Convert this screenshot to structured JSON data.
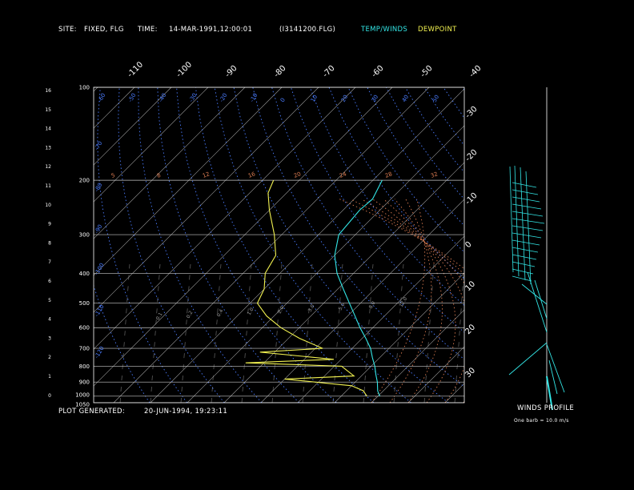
{
  "header": {
    "site_label": "SITE:",
    "site_value": "FIXED, FLG",
    "time_label": "TIME:",
    "time_value": "14-MAR-1991,12:00:01",
    "file_value": "(I3141200.FLG)",
    "legend_temp": "TEMP/WINDS",
    "legend_dew": "DEWPOINT"
  },
  "footer": {
    "generated_label": "PLOT GENERATED:",
    "generated_value": "20-JUN-1994, 19:23:11",
    "winds_title": "WINDS PROFILE",
    "barb_note": "One barb = 10.0 m/s"
  },
  "colors": {
    "background": "#000000",
    "frame": "#ffffff",
    "isobar": "#c8c8c8",
    "isotherm": "#a0a0a0",
    "dry_adiabat": "#4a7cff",
    "moist_adiabat": "#d87a50",
    "mixing_ratio": "#7a7a7a",
    "temperature": "#33e6e6",
    "dewpoint": "#f0f050",
    "wind": "#33e6e6"
  },
  "chart_data": {
    "type": "line",
    "title": "",
    "pressure_axis": {
      "ticks": [
        "100",
        "200",
        "300",
        "400",
        "500",
        "600",
        "700",
        "800",
        "900",
        "1000",
        "1050"
      ],
      "values": [
        100,
        200,
        300,
        400,
        500,
        600,
        700,
        800,
        900,
        1000,
        1050
      ],
      "range": [
        100,
        1050
      ]
    },
    "height_axis": {
      "ticks": [
        "16",
        "15",
        "14",
        "13",
        "12",
        "11",
        "10",
        "9",
        "8",
        "7",
        "6",
        "5",
        "4",
        "3",
        "2",
        "1",
        "0"
      ],
      "values": [
        16,
        15,
        14,
        13,
        12,
        11,
        10,
        9,
        8,
        7,
        6,
        5,
        4,
        3,
        2,
        1,
        0
      ]
    },
    "top_temp_labels": [
      "-110",
      "-100",
      "-90",
      "-80",
      "-70",
      "-60",
      "-50",
      "-40"
    ],
    "right_temp_labels": [
      "-30",
      "-20",
      "-10",
      "0",
      "10",
      "20",
      "30"
    ],
    "dry_adiabat_labels_top": [
      "-60",
      "-50",
      "-40",
      "-30",
      "-20",
      "-10",
      "0",
      "10",
      "20",
      "30",
      "40",
      "50"
    ],
    "dry_adiabat_labels_left": [
      "-70",
      "-80",
      "-90",
      "-100",
      "-110",
      "-120"
    ],
    "moist_labels": [
      "5",
      "8",
      "12",
      "16",
      "20",
      "24",
      "28",
      "32"
    ],
    "mixing_ratio_labels": [
      "0.1",
      "0.2",
      "0.4",
      "1.0",
      "2.0",
      "3.0",
      "5.0",
      "8.0",
      "12.0"
    ],
    "temperature_profile": [
      {
        "p": 1000,
        "t": 0.5
      },
      {
        "p": 962,
        "t": -1.5
      },
      {
        "p": 900,
        "t": -4.0
      },
      {
        "p": 850,
        "t": -6.5
      },
      {
        "p": 800,
        "t": -9.0
      },
      {
        "p": 750,
        "t": -12.0
      },
      {
        "p": 700,
        "t": -15.0
      },
      {
        "p": 650,
        "t": -19.0
      },
      {
        "p": 600,
        "t": -23.5
      },
      {
        "p": 550,
        "t": -28.0
      },
      {
        "p": 500,
        "t": -33.0
      },
      {
        "p": 450,
        "t": -38.5
      },
      {
        "p": 400,
        "t": -44.5
      },
      {
        "p": 350,
        "t": -50.0
      },
      {
        "p": 300,
        "t": -54.5
      },
      {
        "p": 250,
        "t": -55.5
      },
      {
        "p": 230,
        "t": -55.0
      },
      {
        "p": 200,
        "t": -57.5
      }
    ],
    "dewpoint_profile": [
      {
        "p": 1000,
        "td": -3.0
      },
      {
        "p": 960,
        "td": -5.5
      },
      {
        "p": 925,
        "td": -10.0
      },
      {
        "p": 880,
        "td": -30.0
      },
      {
        "p": 860,
        "td": -12.0
      },
      {
        "p": 800,
        "td": -18.0
      },
      {
        "p": 780,
        "td": -45.0
      },
      {
        "p": 760,
        "td": -22.0
      },
      {
        "p": 720,
        "td": -44.0
      },
      {
        "p": 700,
        "td": -28.0
      },
      {
        "p": 650,
        "td": -37.0
      },
      {
        "p": 600,
        "td": -45.0
      },
      {
        "p": 550,
        "td": -52.0
      },
      {
        "p": 500,
        "td": -58.0
      },
      {
        "p": 450,
        "td": -60.0
      },
      {
        "p": 400,
        "td": -64.0
      },
      {
        "p": 350,
        "td": -66.0
      },
      {
        "p": 300,
        "td": -72.0
      },
      {
        "p": 250,
        "td": -80.0
      },
      {
        "p": 220,
        "td": -85.0
      },
      {
        "p": 200,
        "td": -87.0
      }
    ]
  }
}
